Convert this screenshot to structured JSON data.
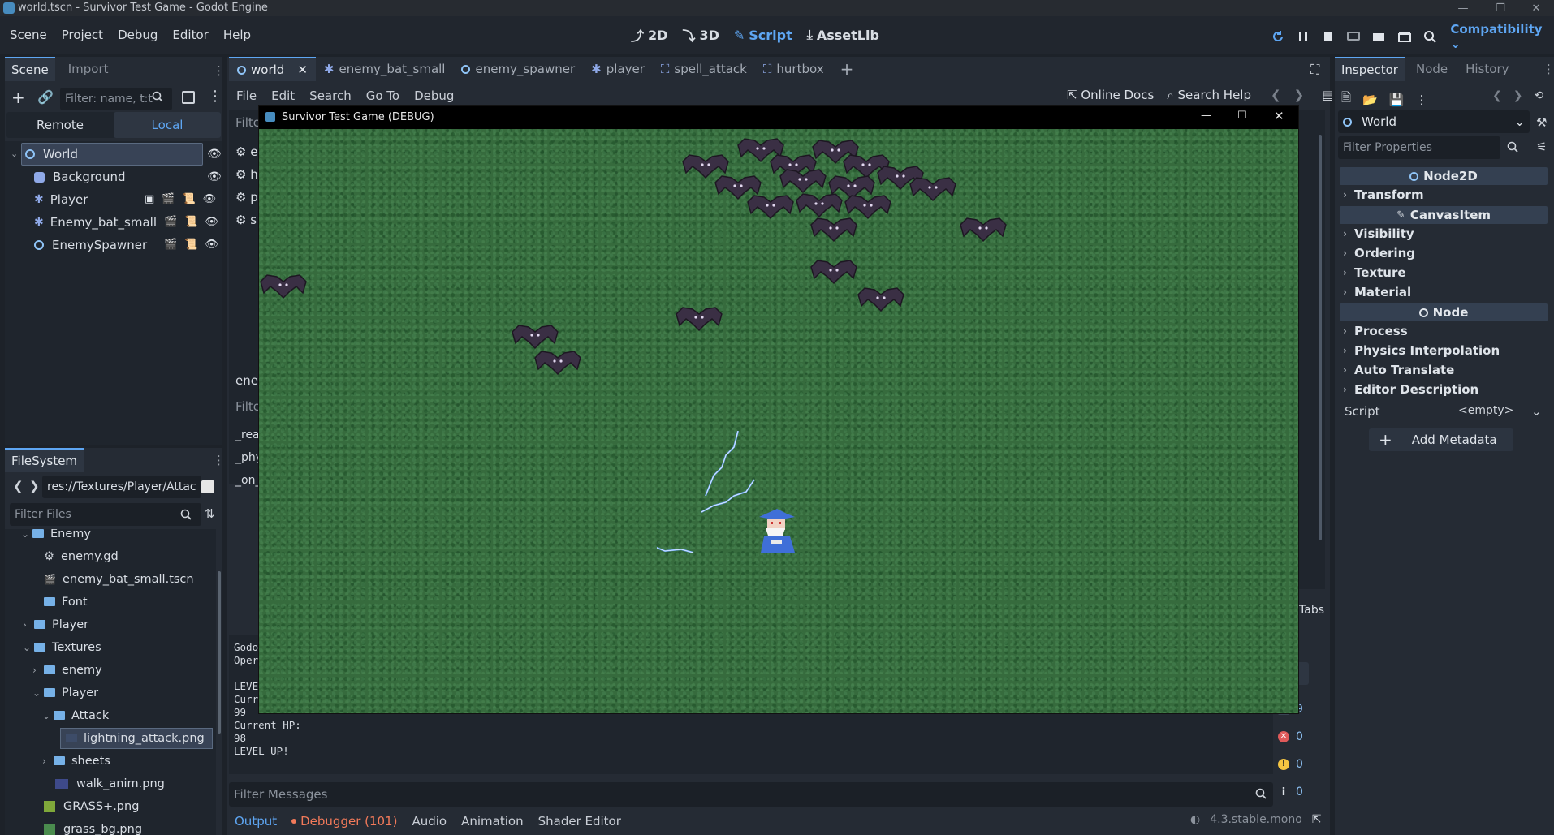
{
  "titlebar": {
    "title": "world.tscn - Survivor Test Game - Godot Engine"
  },
  "menubar": {
    "menus": [
      "Scene",
      "Project",
      "Debug",
      "Editor",
      "Help"
    ],
    "workspaces": [
      "2D",
      "3D",
      "Script",
      "AssetLib"
    ],
    "active_workspace": "Script",
    "renderer": "Compatibility"
  },
  "scene_dock": {
    "tabs": [
      "Scene",
      "Import"
    ],
    "filter_placeholder": "Filter: name, t:t",
    "remote_label": "Remote",
    "local_label": "Local",
    "nodes": [
      "World",
      "Background",
      "Player",
      "Enemy_bat_small",
      "EnemySpawner"
    ]
  },
  "filesystem": {
    "tab": "FileSystem",
    "path": "res://Textures/Player/Attac",
    "filter_placeholder": "Filter Files",
    "items": [
      "Enemy",
      "enemy.gd",
      "enemy_bat_small.tscn",
      "Font",
      "Player",
      "Textures",
      "enemy",
      "Player",
      "Attack",
      "lightning_attack.png",
      "sheets",
      "walk_anim.png",
      "GRASS+.png",
      "grass_bg.png"
    ]
  },
  "editor_tabs": [
    "world",
    "enemy_bat_small",
    "enemy_spawner",
    "player",
    "spell_attack",
    "hurtbox"
  ],
  "script_menu": [
    "File",
    "Edit",
    "Search",
    "Go To",
    "Debug"
  ],
  "script_links": {
    "online_docs": "Online Docs",
    "search_help": "Search Help"
  },
  "script_side": {
    "filter1": "Filter",
    "files": [
      "e",
      "h",
      "p",
      "s"
    ],
    "current": "ener",
    "filter2": "Filte",
    "methods": [
      "_rea",
      "_phy",
      "_on_"
    ]
  },
  "game_window": {
    "title": "Survivor Test Game (DEBUG)"
  },
  "output": {
    "lines": [
      "Godo",
      "Oper",
      "",
      "LEVE",
      "Curr",
      "99",
      "Current HP:",
      "98",
      "LEVEL UP!"
    ],
    "filter_placeholder": "Filter Messages",
    "tabs_label": "Tabs",
    "counts": {
      "messages": "9",
      "errors": "0",
      "warnings": "0",
      "info": "0"
    }
  },
  "bottom_tabs": [
    "Output",
    "Debugger (101)",
    "Audio",
    "Animation",
    "Shader Editor"
  ],
  "version": "4.3.stable.mono",
  "inspector": {
    "tabs": [
      "Inspector",
      "Node",
      "History"
    ],
    "object": "World",
    "filter_placeholder": "Filter Properties",
    "class_headers": [
      "Node2D",
      "CanvasItem",
      "Node"
    ],
    "node2d_sections": [
      "Transform"
    ],
    "canvasitem_sections": [
      "Visibility",
      "Ordering",
      "Texture",
      "Material"
    ],
    "node_sections": [
      "Process",
      "Physics Interpolation",
      "Auto Translate",
      "Editor Description"
    ],
    "script_label": "Script",
    "script_value": "<empty>",
    "add_metadata": "Add Metadata"
  },
  "colors": {
    "accent": "#5ea6f3",
    "bg": "#1d2229",
    "panel": "#252b34",
    "grass": "#366b3d",
    "error": "#e05a5a",
    "warning": "#f4c542"
  }
}
